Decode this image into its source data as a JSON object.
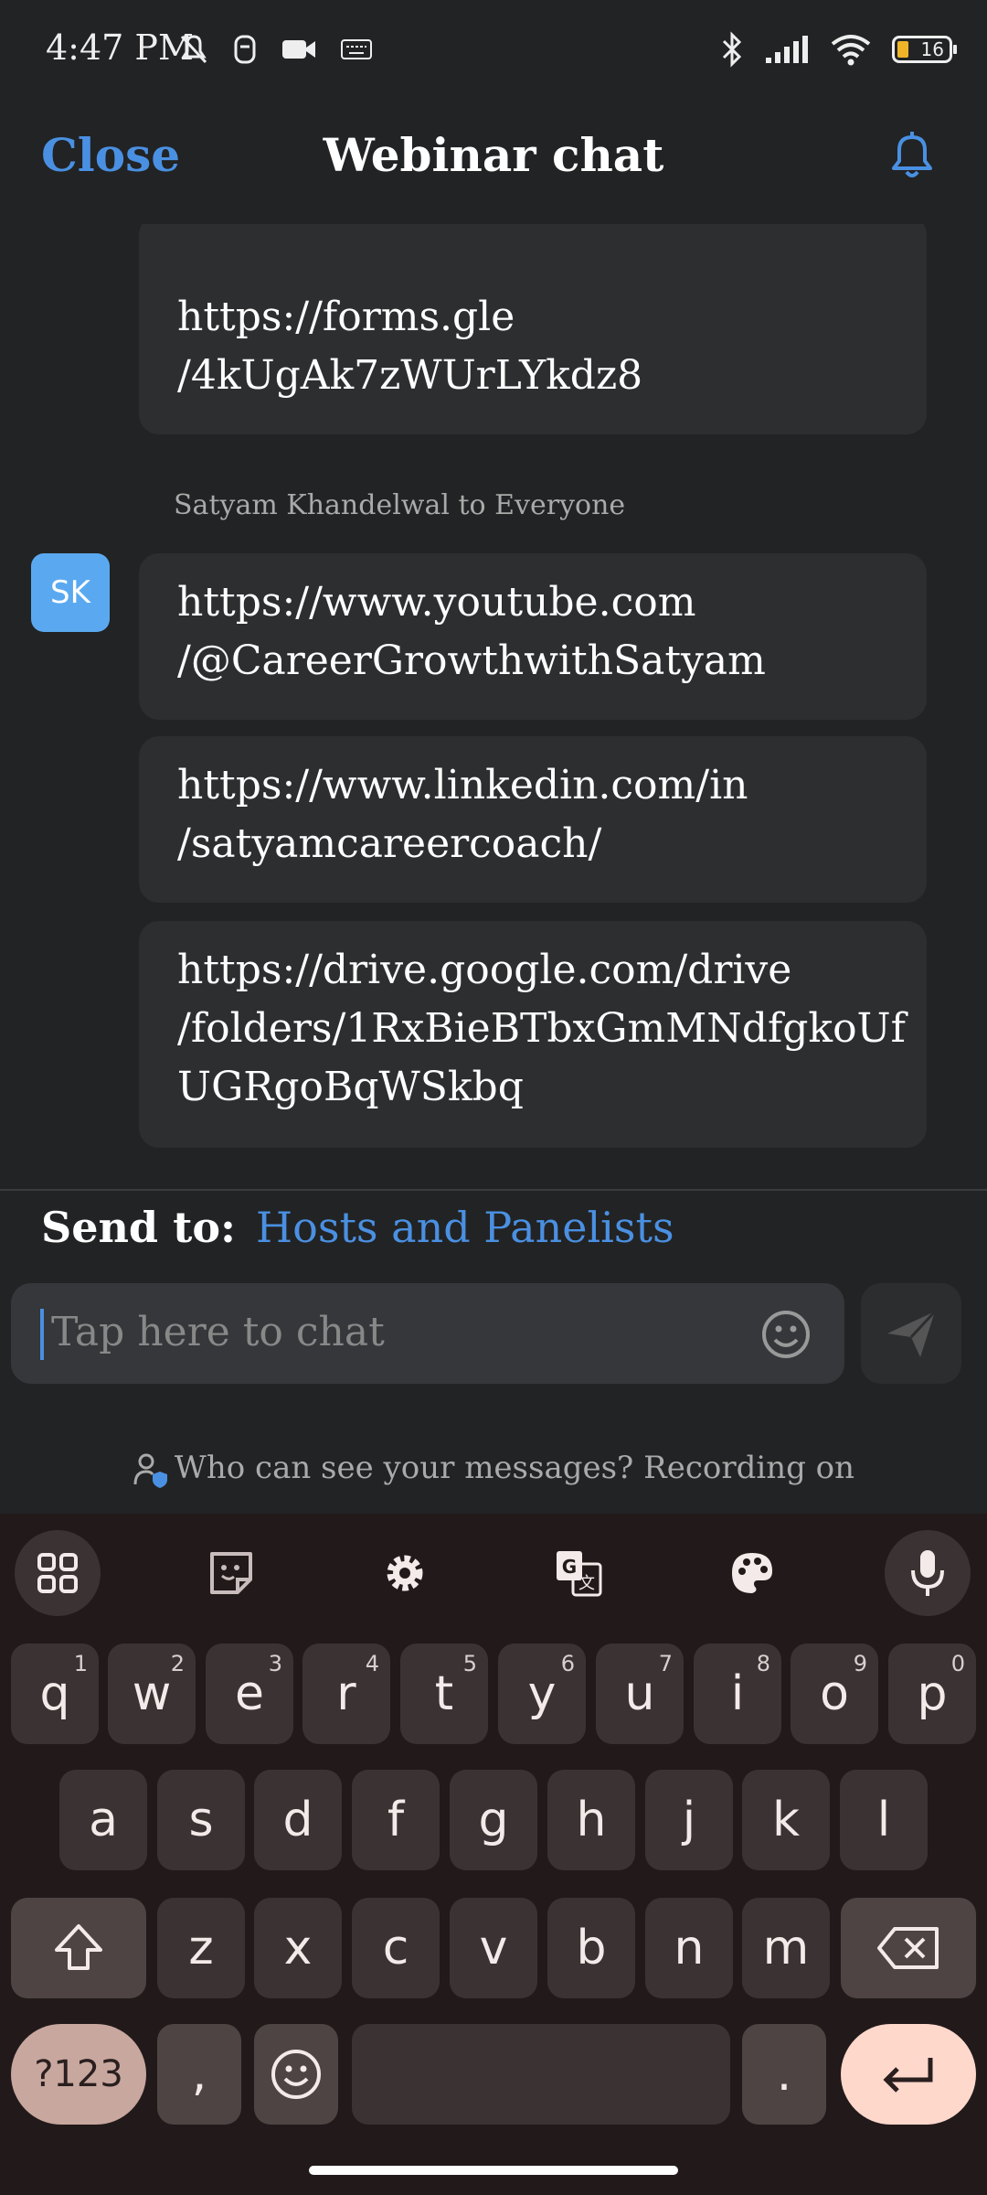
{
  "status_bar": {
    "time": "4:47 PM",
    "battery": "16"
  },
  "header": {
    "close_label": "Close",
    "title": "Webinar chat"
  },
  "messages": {
    "first_bubble": [
      "https://forms.gle",
      "/4kUgAk7zWUrLYkdz8"
    ],
    "sender_line": "Satyam Khandelwal to Everyone",
    "avatar_initials": "SK",
    "bubbles": [
      [
        "https://www.youtube.com",
        "/@CareerGrowthwithSatyam"
      ],
      [
        "https://www.linkedin.com/in",
        "/satyamcareercoach/"
      ],
      [
        "https://drive.google.com/drive",
        "/folders/1RxBieBTbxGmMNdfgkoUf",
        "UGRgoBqWSkbq"
      ]
    ]
  },
  "composer": {
    "send_to_label": "Send to:",
    "send_to_target": "Hosts and Panelists",
    "placeholder": "Tap here to chat"
  },
  "privacy_note": "Who can see your messages? Recording on",
  "keyboard": {
    "row1": [
      {
        "k": "q",
        "h": "1"
      },
      {
        "k": "w",
        "h": "2"
      },
      {
        "k": "e",
        "h": "3"
      },
      {
        "k": "r",
        "h": "4"
      },
      {
        "k": "t",
        "h": "5"
      },
      {
        "k": "y",
        "h": "6"
      },
      {
        "k": "u",
        "h": "7"
      },
      {
        "k": "i",
        "h": "8"
      },
      {
        "k": "o",
        "h": "9"
      },
      {
        "k": "p",
        "h": "0"
      }
    ],
    "row2": [
      "a",
      "s",
      "d",
      "f",
      "g",
      "h",
      "j",
      "k",
      "l"
    ],
    "row3": [
      "z",
      "x",
      "c",
      "v",
      "b",
      "n",
      "m"
    ],
    "sym_label": "?123",
    "comma": ",",
    "period": "."
  },
  "colors": {
    "accent": "#4a90e2",
    "avatar": "#5aa9f0",
    "bubble": "#2d2e30",
    "keyboard_bg": "#221a1a",
    "enter_key": "#ffd8cc"
  }
}
